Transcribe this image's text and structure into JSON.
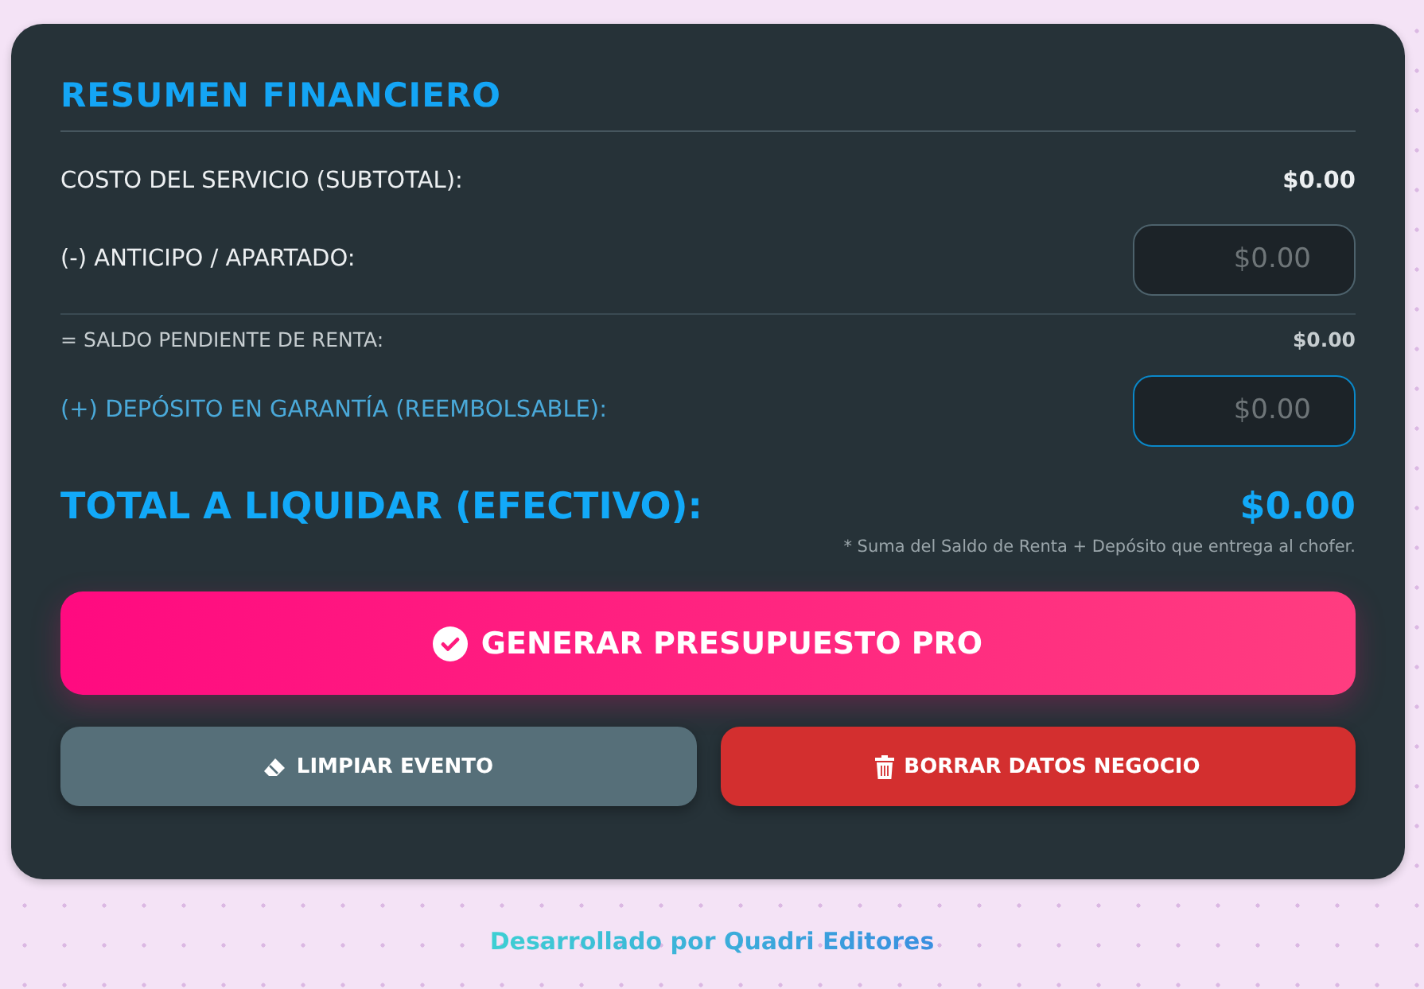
{
  "summary": {
    "title": "RESUMEN FINANCIERO",
    "rows": [
      {
        "kind": "value",
        "label": "COSTO DEL SERVICIO (SUBTOTAL):",
        "value": "$0.00"
      },
      {
        "kind": "input",
        "label": "(-) ANTICIPO / APARTADO:",
        "placeholder": "$0.00",
        "focused": false
      },
      {
        "kind": "subtotal",
        "label": "= SALDO PENDIENTE DE RENTA:",
        "value": "$0.00"
      },
      {
        "kind": "input",
        "label": "(+) DEPÓSITO EN GARANTÍA (REEMBOLSABLE):",
        "placeholder": "$0.00",
        "focused": true
      }
    ],
    "total": {
      "label": "TOTAL A LIQUIDAR (EFECTIVO):",
      "value": "$0.00",
      "note": "* Suma del Saldo de Renta + Depósito que entrega al chofer."
    },
    "primary_button": "GENERAR PRESUPUESTO PRO",
    "buttons": [
      {
        "kind": "clear",
        "label": "LIMPIAR EVENTO"
      },
      {
        "kind": "delete",
        "label": "BORRAR DATOS NEGOCIO"
      }
    ]
  },
  "footer": "Desarrollado por Quadri Editores"
}
